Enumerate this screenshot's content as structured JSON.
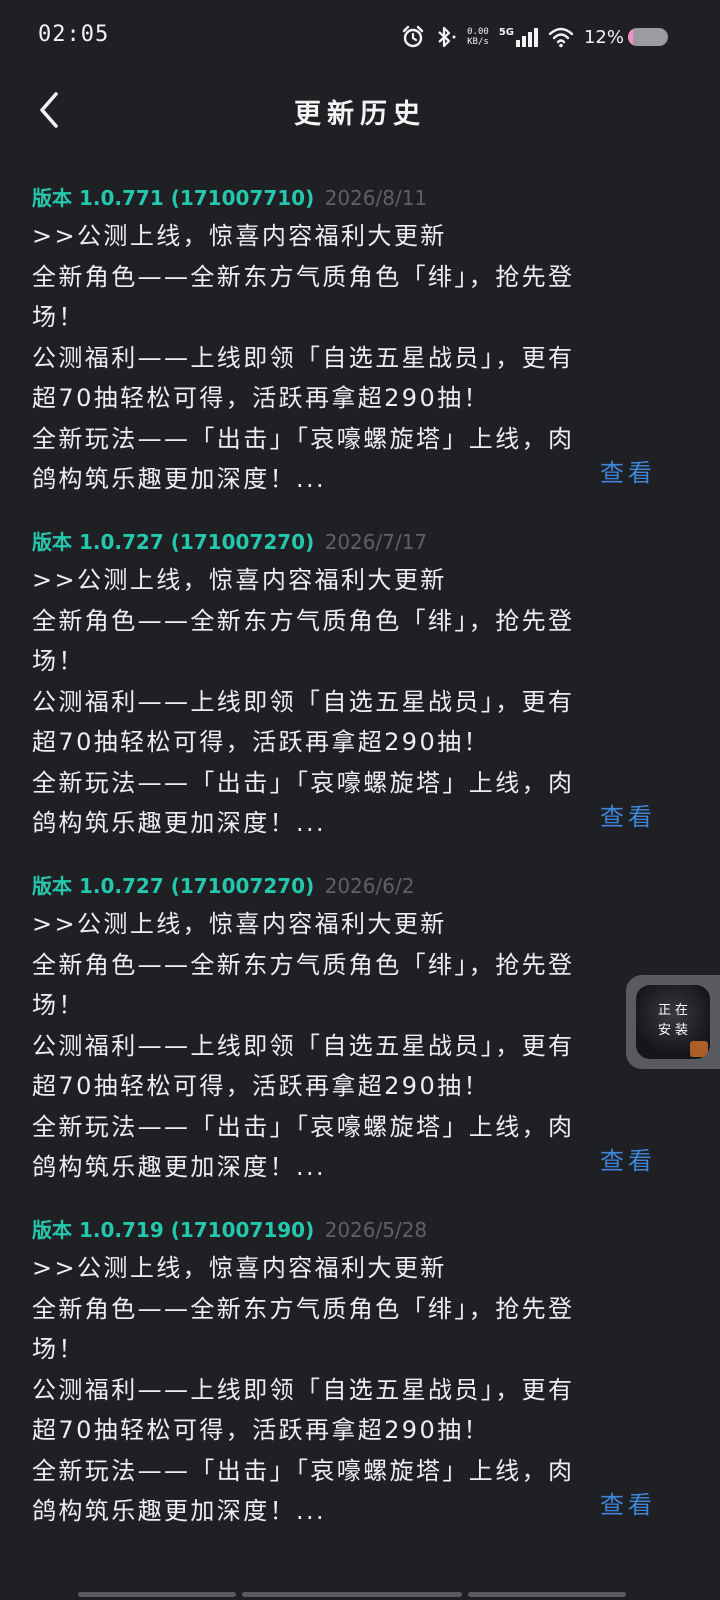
{
  "status_bar": {
    "time": "02:05",
    "net_speed_value": "0.00",
    "net_speed_unit": "KB/s",
    "network": "5G",
    "battery_percent": "12%",
    "battery_level": 0.12,
    "battery_color": "#f291c8"
  },
  "header": {
    "title": "更新历史",
    "back_icon": "back-arrow-icon"
  },
  "entries": [
    {
      "version": "版本 1.0.771 (171007710)",
      "date": "2026/8/11",
      "lines": [
        ">>公测上线，惊喜内容福利大更新",
        "全新角色——全新东方气质角色「绯」，抢先登",
        "场！",
        "公测福利——上线即领「自选五星战员」，更有",
        "超70抽轻松可得，活跃再拿超290抽！",
        "全新玩法——「出击」「哀嚎螺旋塔」上线，肉",
        "鸽构筑乐趣更加深度！..."
      ],
      "view_label": "查看"
    },
    {
      "version": "版本 1.0.727 (171007270)",
      "date": "2026/7/17",
      "lines": [
        ">>公测上线，惊喜内容福利大更新",
        "全新角色——全新东方气质角色「绯」，抢先登",
        "场！",
        "公测福利——上线即领「自选五星战员」，更有",
        "超70抽轻松可得，活跃再拿超290抽！",
        "全新玩法——「出击」「哀嚎螺旋塔」上线，肉",
        "鸽构筑乐趣更加深度！..."
      ],
      "view_label": "查看"
    },
    {
      "version": "版本 1.0.727 (171007270)",
      "date": "2026/6/2",
      "lines": [
        ">>公测上线，惊喜内容福利大更新",
        "全新角色——全新东方气质角色「绯」，抢先登",
        "场！",
        "公测福利——上线即领「自选五星战员」，更有",
        "超70抽轻松可得，活跃再拿超290抽！",
        "全新玩法——「出击」「哀嚎螺旋塔」上线，肉",
        "鸽构筑乐趣更加深度！..."
      ],
      "view_label": "查看"
    },
    {
      "version": "版本 1.0.719 (171007190)",
      "date": "2026/5/28",
      "lines": [
        ">>公测上线，惊喜内容福利大更新",
        "全新角色——全新东方气质角色「绯」，抢先登",
        "场！",
        "公测福利——上线即领「自选五星战员」，更有",
        "超70抽轻松可得，活跃再拿超290抽！",
        "全新玩法——「出击」「哀嚎螺旋塔」上线，肉",
        "鸽构筑乐趣更加深度！..."
      ],
      "view_label": "查看"
    }
  ],
  "install_float": {
    "text_line1": "正在",
    "text_line2": "安装"
  },
  "colors": {
    "background": "#1f2024",
    "version_accent": "#25c8ad",
    "date_gray": "#5f6166",
    "link_blue": "#3f86d8"
  }
}
